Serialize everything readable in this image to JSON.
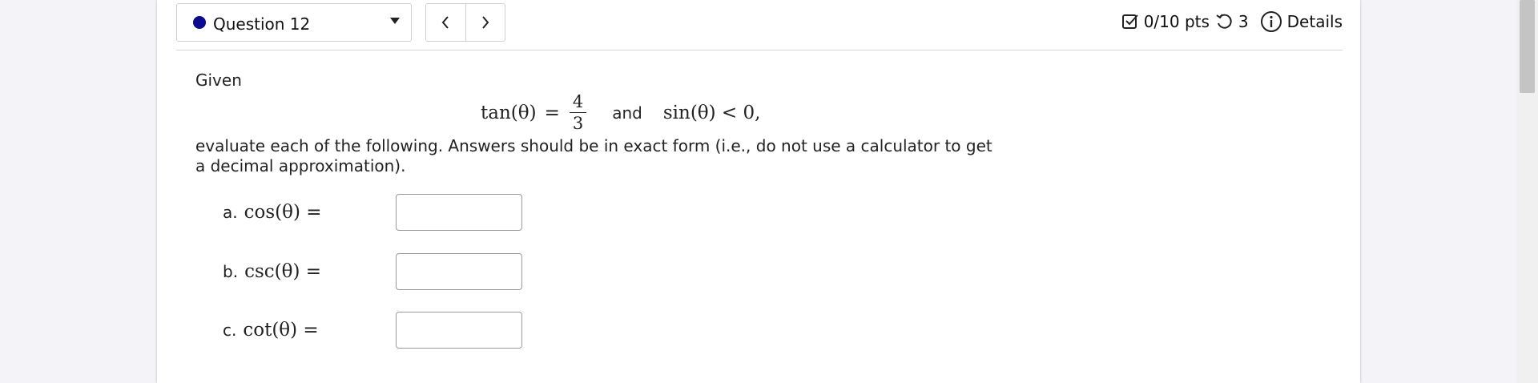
{
  "header": {
    "question_label": "Question 12",
    "status_dot_color": "#0b0b8f",
    "points": "0/10 pts",
    "attempts": "3",
    "details_label": "Details",
    "icons": {
      "prev": "chevron-left-icon",
      "next": "chevron-right-icon",
      "dropdown": "caret-down-icon",
      "points": "checkbox-icon",
      "attempts": "retry-icon",
      "details": "info-icon"
    }
  },
  "problem": {
    "given_label": "Given",
    "equation": {
      "lhs": "tan(θ)",
      "equals": "=",
      "numerator": "4",
      "denominator": "3",
      "conjunction": "and",
      "condition": "sin(θ) < 0,"
    },
    "instructions": "evaluate each of the following. Answers should be in exact form (i.e., do not use a calculator to get a decimal approximation).",
    "parts": [
      {
        "letter": "a.",
        "expression": "cos(θ) =",
        "value": ""
      },
      {
        "letter": "b.",
        "expression": "csc(θ) =",
        "value": ""
      },
      {
        "letter": "c.",
        "expression": "cot(θ) =",
        "value": ""
      }
    ]
  }
}
